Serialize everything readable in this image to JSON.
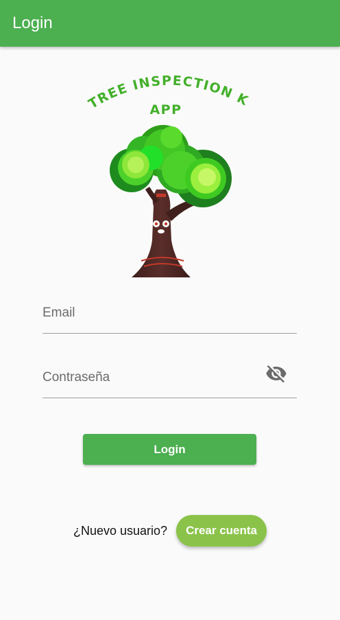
{
  "appbar": {
    "title": "Login",
    "color": "#4caf50"
  },
  "logo": {
    "text_line1": "TREE INSPECTION KIT",
    "text_line2": "APP",
    "text_color": "#43b02a"
  },
  "form": {
    "email_placeholder": "Email",
    "email_value": "",
    "password_placeholder": "Contraseña",
    "password_value": "",
    "visibility_icon": "visibility-off-icon"
  },
  "actions": {
    "login_label": "Login",
    "signup_prompt": "¿Nuevo usuario?",
    "signup_label": "Crear cuenta",
    "login_color": "#4caf50",
    "signup_color": "#8bc34a"
  }
}
